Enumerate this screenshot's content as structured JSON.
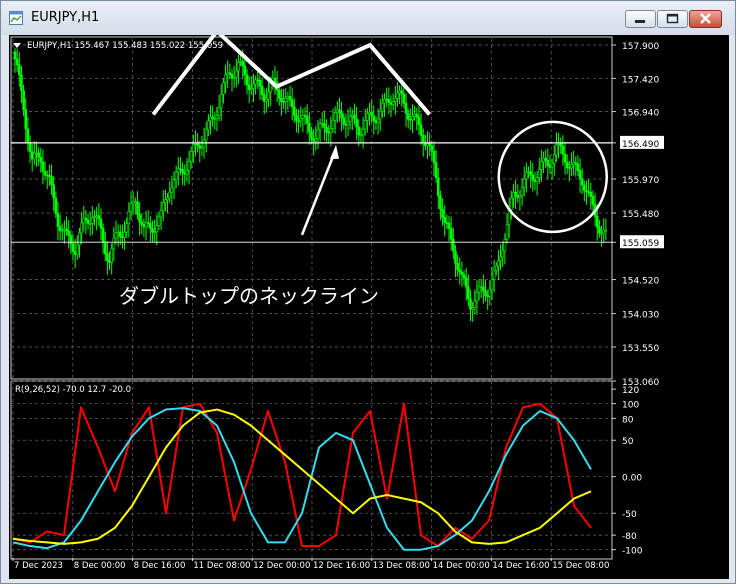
{
  "window": {
    "title": "EURJPY,H1",
    "buttons": {
      "minimize": "minimize-icon",
      "maximize": "maximize-icon",
      "close": "close-icon"
    }
  },
  "colors": {
    "background": "#000000",
    "grid": "#6b6b6b",
    "candles": "#00ff00",
    "axis_text": "#ffffff",
    "annotation": "#ffffff",
    "osc_red": "#ff0000",
    "osc_cyan": "#33ddee",
    "osc_yellow": "#ffff00"
  },
  "chart_data": [
    {
      "type": "candlestick",
      "info": "EURJPY,H1  155.467 155.483 155.022 155.059",
      "y_ticks": [
        "157.900",
        "157.420",
        "156.940",
        "156.490",
        "155.970",
        "155.480",
        "155.059",
        "154.520",
        "154.030",
        "153.550",
        "153.060"
      ],
      "ylim": [
        153.06,
        157.9
      ],
      "highlighted_prices": {
        "neckline": "156.490",
        "current": "155.059"
      },
      "x_labels": [
        "7 Dec 2023",
        "8 Dec 00:00",
        "8 Dec 16:00",
        "11 Dec 08:00",
        "12 Dec 00:00",
        "12 Dec 16:00",
        "13 Dec 08:00",
        "14 Dec 00:00",
        "14 Dec 16:00",
        "15 Dec 08:00"
      ],
      "close_path": [
        [
          0,
          157.7
        ],
        [
          2,
          157.0
        ],
        [
          4,
          156.2
        ],
        [
          6,
          156.3
        ],
        [
          8,
          155.9
        ],
        [
          10,
          155.4
        ],
        [
          12,
          155.1
        ],
        [
          14,
          155.0
        ],
        [
          16,
          155.3
        ],
        [
          18,
          155.5
        ],
        [
          20,
          155.2
        ],
        [
          22,
          154.8
        ],
        [
          24,
          155.2
        ],
        [
          26,
          155.3
        ],
        [
          28,
          155.7
        ],
        [
          30,
          155.2
        ],
        [
          32,
          155.3
        ],
        [
          34,
          155.4
        ],
        [
          36,
          155.9
        ],
        [
          38,
          156.0
        ],
        [
          40,
          156.2
        ],
        [
          42,
          156.4
        ],
        [
          44,
          156.6
        ],
        [
          46,
          156.8
        ],
        [
          48,
          157.2
        ],
        [
          50,
          157.5
        ],
        [
          52,
          157.6
        ],
        [
          54,
          157.4
        ],
        [
          56,
          157.3
        ],
        [
          58,
          157.2
        ],
        [
          60,
          157.3
        ],
        [
          62,
          157.2
        ],
        [
          64,
          157.0
        ],
        [
          66,
          156.9
        ],
        [
          68,
          156.7
        ],
        [
          70,
          156.6
        ],
        [
          72,
          156.7
        ],
        [
          74,
          156.8
        ],
        [
          76,
          156.9
        ],
        [
          78,
          156.8
        ],
        [
          80,
          156.7
        ],
        [
          82,
          156.8
        ],
        [
          84,
          156.9
        ],
        [
          86,
          157.0
        ],
        [
          88,
          157.2
        ],
        [
          90,
          157.1
        ],
        [
          92,
          156.9
        ],
        [
          94,
          156.7
        ],
        [
          96,
          156.5
        ],
        [
          98,
          156.0
        ],
        [
          100,
          155.3
        ],
        [
          102,
          155.0
        ],
        [
          104,
          154.5
        ],
        [
          106,
          154.2
        ],
        [
          108,
          154.3
        ],
        [
          110,
          154.4
        ],
        [
          112,
          154.6
        ],
        [
          114,
          155.2
        ],
        [
          116,
          155.7
        ],
        [
          118,
          155.9
        ],
        [
          120,
          156.0
        ],
        [
          122,
          156.1
        ],
        [
          124,
          156.2
        ],
        [
          126,
          156.4
        ],
        [
          128,
          156.3
        ],
        [
          130,
          156.1
        ],
        [
          132,
          156.0
        ],
        [
          134,
          155.6
        ],
        [
          136,
          155.3
        ],
        [
          138,
          155.06
        ]
      ],
      "annotations": {
        "label": "ダブルトップのネックライン",
        "double_top_zigzag_prices": [
          156.9,
          158.1,
          157.3,
          157.9,
          156.9
        ],
        "circle_center": [
          127,
          156.0
        ]
      }
    },
    {
      "type": "line",
      "title": "R(9,26,52) -70.0 12.7 -20.0",
      "y_ticks": [
        "120",
        "100",
        "80",
        "50",
        "0.00",
        "-50",
        "-80",
        "-100"
      ],
      "y_tick_values": [
        120,
        100,
        80,
        50,
        0,
        -50,
        -80,
        -100
      ],
      "ylim": [
        -110,
        127
      ],
      "x": [
        0,
        4,
        8,
        12,
        16,
        20,
        24,
        28,
        32,
        36,
        40,
        44,
        48,
        52,
        56,
        60,
        64,
        68,
        72,
        76,
        80,
        84,
        88,
        92,
        96,
        100,
        104,
        108,
        112,
        116,
        120,
        124,
        128,
        132,
        136
      ],
      "series": [
        {
          "color": "#ff0000",
          "values": [
            -85,
            -90,
            -75,
            -80,
            95,
            40,
            -20,
            60,
            95,
            -50,
            95,
            100,
            60,
            -60,
            10,
            90,
            20,
            -95,
            -95,
            -80,
            60,
            90,
            -30,
            100,
            -80,
            -95,
            -70,
            -85,
            -60,
            40,
            95,
            100,
            80,
            -40,
            -70
          ]
        },
        {
          "color": "#33ddee",
          "values": [
            -90,
            -95,
            -98,
            -90,
            -60,
            -20,
            20,
            55,
            80,
            92,
            94,
            90,
            70,
            20,
            -50,
            -90,
            -90,
            -50,
            40,
            60,
            50,
            -10,
            -70,
            -100,
            -100,
            -95,
            -80,
            -60,
            -20,
            30,
            70,
            90,
            80,
            50,
            10
          ]
        },
        {
          "color": "#ffff00",
          "values": [
            -85,
            -88,
            -90,
            -92,
            -90,
            -85,
            -70,
            -40,
            0,
            40,
            70,
            88,
            92,
            85,
            70,
            50,
            30,
            10,
            -10,
            -30,
            -50,
            -30,
            -25,
            -30,
            -35,
            -50,
            -75,
            -90,
            -92,
            -90,
            -80,
            -70,
            -50,
            -30,
            -20
          ]
        }
      ]
    }
  ]
}
